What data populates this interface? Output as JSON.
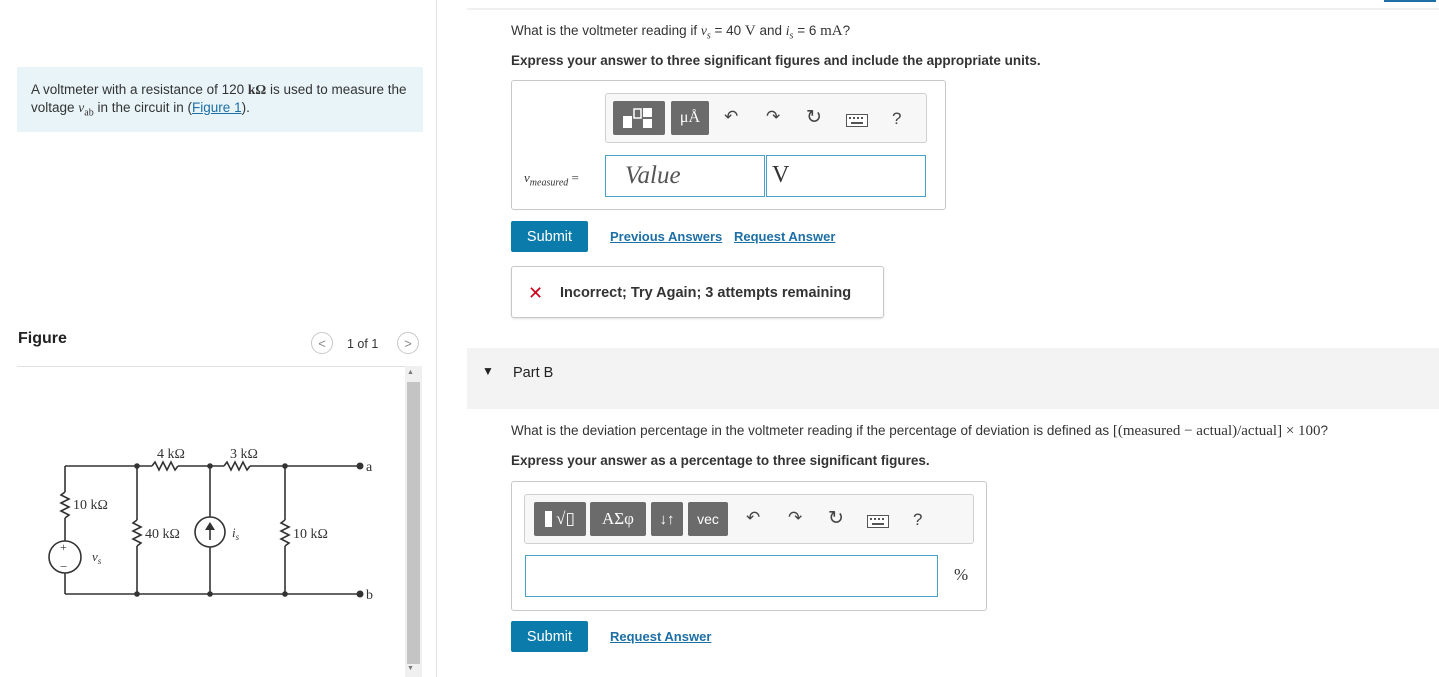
{
  "problem": {
    "text_before": "A voltmeter with a resistance of 120 ",
    "unit_kohm": "kΩ",
    "text_mid": " is used to measure the voltage ",
    "var_v": "v",
    "var_sub": "ab",
    "text_after": " in the circuit in (",
    "figure_link": "Figure 1",
    "text_end": ")."
  },
  "figure": {
    "title": "Figure",
    "pager": "1 of 1",
    "prev_glyph": "<",
    "next_glyph": ">",
    "circuit": {
      "r_top1": "4 kΩ",
      "r_top2": "3 kΩ",
      "r_left": "10 kΩ",
      "r_mid": "40 kΩ",
      "r_right": "10 kΩ",
      "source_v": "v",
      "source_v_sub": "s",
      "source_i": "i",
      "source_i_sub": "s",
      "node_a": "a",
      "node_b": "b",
      "plus": "+",
      "minus": "−"
    }
  },
  "part_a": {
    "q_text1": "What is the voltmeter reading if ",
    "q_var_v": "v",
    "q_sub_s1": "s",
    "q_eq1": " = 40 ",
    "q_unit_v": "V",
    "q_and": " and ",
    "q_var_i": "i",
    "q_sub_s2": "s",
    "q_eq2": " = 6 ",
    "q_unit_ma": "mA",
    "q_end": "?",
    "instruction": "Express your answer to three significant figures and include the appropriate units.",
    "toolbar_units": "μÅ",
    "toolbar_help": "?",
    "label_var": "v",
    "label_sub": "measured",
    "label_eq": " =",
    "value_placeholder": "Value",
    "unit_value": "V",
    "submit": "Submit",
    "previous_answers": "Previous Answers",
    "request_answer": "Request Answer",
    "feedback_icon": "✕",
    "feedback_text": "Incorrect; Try Again; 3 attempts remaining"
  },
  "part_b": {
    "title": "Part B",
    "q_text": "What is the deviation percentage in the voltmeter reading if the percentage of deviation is defined as ",
    "q_formula": "[(measured − actual)/actual] × 100",
    "q_end": "?",
    "instruction": "Express your answer as a percentage to three significant figures.",
    "toolbar_sqrt": "√▯",
    "toolbar_greek": "ΑΣφ",
    "toolbar_arrows": "↓↑",
    "toolbar_vec": "vec",
    "toolbar_help": "?",
    "unit": "%",
    "submit": "Submit",
    "request_answer": "Request Answer"
  }
}
